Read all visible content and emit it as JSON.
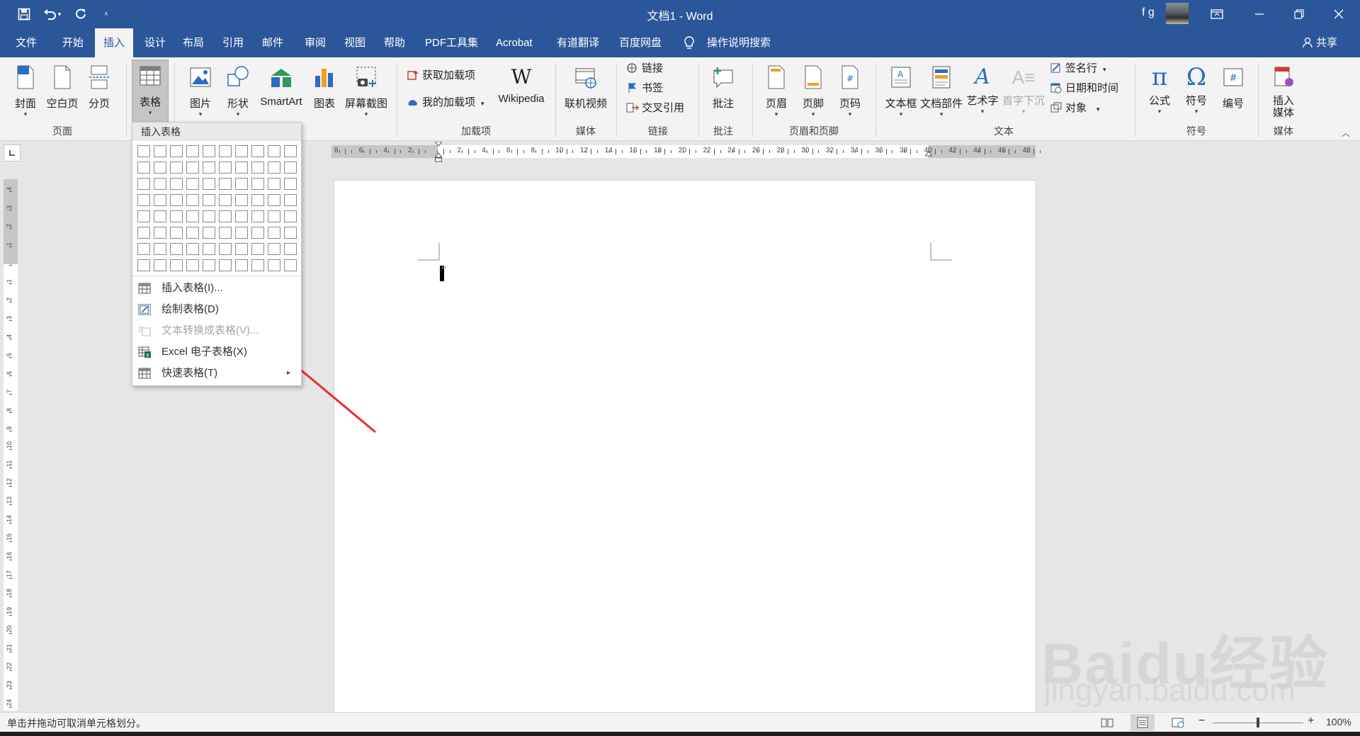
{
  "window": {
    "title": "文档1  -  Word",
    "user_name": "f g",
    "title_icons": [
      "save-icon",
      "undo-icon",
      "undo-dropdown-icon",
      "redo-icon",
      "customize-quick-access-icon"
    ],
    "win_controls": [
      "ribbon-display-icon",
      "minimize-icon",
      "restore-icon",
      "close-icon"
    ],
    "accent_color": "#2b579a"
  },
  "tabs": [
    {
      "label": "文件"
    },
    {
      "label": "开始"
    },
    {
      "label": "插入"
    },
    {
      "label": "设计"
    },
    {
      "label": "布局"
    },
    {
      "label": "引用"
    },
    {
      "label": "邮件"
    },
    {
      "label": "审阅"
    },
    {
      "label": "视图"
    },
    {
      "label": "帮助"
    },
    {
      "label": "PDF工具集"
    },
    {
      "label": "Acrobat"
    },
    {
      "label": "有道翻译"
    },
    {
      "label": "百度网盘"
    }
  ],
  "tell_me": "操作说明搜索",
  "share": "共享",
  "ribbon": {
    "pages": {
      "cover": "封面",
      "blank": "空白页",
      "break": "分页",
      "group": "页面"
    },
    "table": {
      "label": "表格",
      "group": "表格"
    },
    "illus": {
      "picture": "图片",
      "shapes": "形状",
      "smartart": "SmartArt",
      "chart": "图表",
      "screenshot": "屏幕截图"
    },
    "addins": {
      "get": "获取加载项",
      "mine": "我的加载项",
      "wikipedia": "Wikipedia",
      "group": "加载项"
    },
    "media": {
      "online_video": "联机视频",
      "group": "媒体"
    },
    "links": {
      "link": "链接",
      "bookmark": "书签",
      "crossref": "交叉引用",
      "group": "链接"
    },
    "comments": {
      "comment": "批注",
      "group": "批注"
    },
    "headerfooter": {
      "header": "页眉",
      "footer": "页脚",
      "page_number": "页码",
      "group": "页眉和页脚"
    },
    "text": {
      "textbox": "文本框",
      "quickparts": "文档部件",
      "wordart": "艺术字",
      "dropcap": "首字下沉",
      "signature": "签名行",
      "datetime": "日期和时间",
      "object": "对象",
      "group": "文本"
    },
    "symbols": {
      "equation": "公式",
      "symbol": "符号",
      "number": "编号",
      "group": "符号"
    },
    "media2": {
      "insert_media_line1": "插入",
      "insert_media_line2": "媒体",
      "group": "媒体"
    }
  },
  "table_dropdown": {
    "header": "插入表格",
    "grid": {
      "cols": 10,
      "rows": 8
    },
    "items": [
      {
        "label": "插入表格(I)...",
        "enabled": true
      },
      {
        "label": "绘制表格(D)",
        "enabled": true
      },
      {
        "label": "文本转换成表格(V)...",
        "enabled": false
      },
      {
        "label": "Excel 电子表格(X)",
        "enabled": true
      },
      {
        "label": "快速表格(T)",
        "enabled": true
      }
    ]
  },
  "ruler": {
    "h_labels": [
      "8",
      "6",
      "4",
      "2",
      "",
      "2",
      "4",
      "6",
      "8",
      "10",
      "12",
      "14",
      "16",
      "18",
      "20",
      "22",
      "24",
      "26",
      "28",
      "30",
      "32",
      "34",
      "36",
      "38",
      "40",
      "42",
      "44",
      "46",
      "48"
    ],
    "v_labels": [
      "4",
      "3",
      "2",
      "1",
      "",
      "1",
      "2",
      "3",
      "4",
      "5",
      "6",
      "7",
      "8",
      "9",
      "10",
      "11",
      "12",
      "13",
      "14",
      "15",
      "16",
      "17",
      "18",
      "19",
      "20",
      "21",
      "22",
      "23",
      "24"
    ]
  },
  "status": {
    "message": "单击并拖动可取消单元格划分。",
    "zoom": "100%"
  },
  "watermark": {
    "line1": "Baidu经验",
    "line2": "jingyan.baidu.com"
  }
}
